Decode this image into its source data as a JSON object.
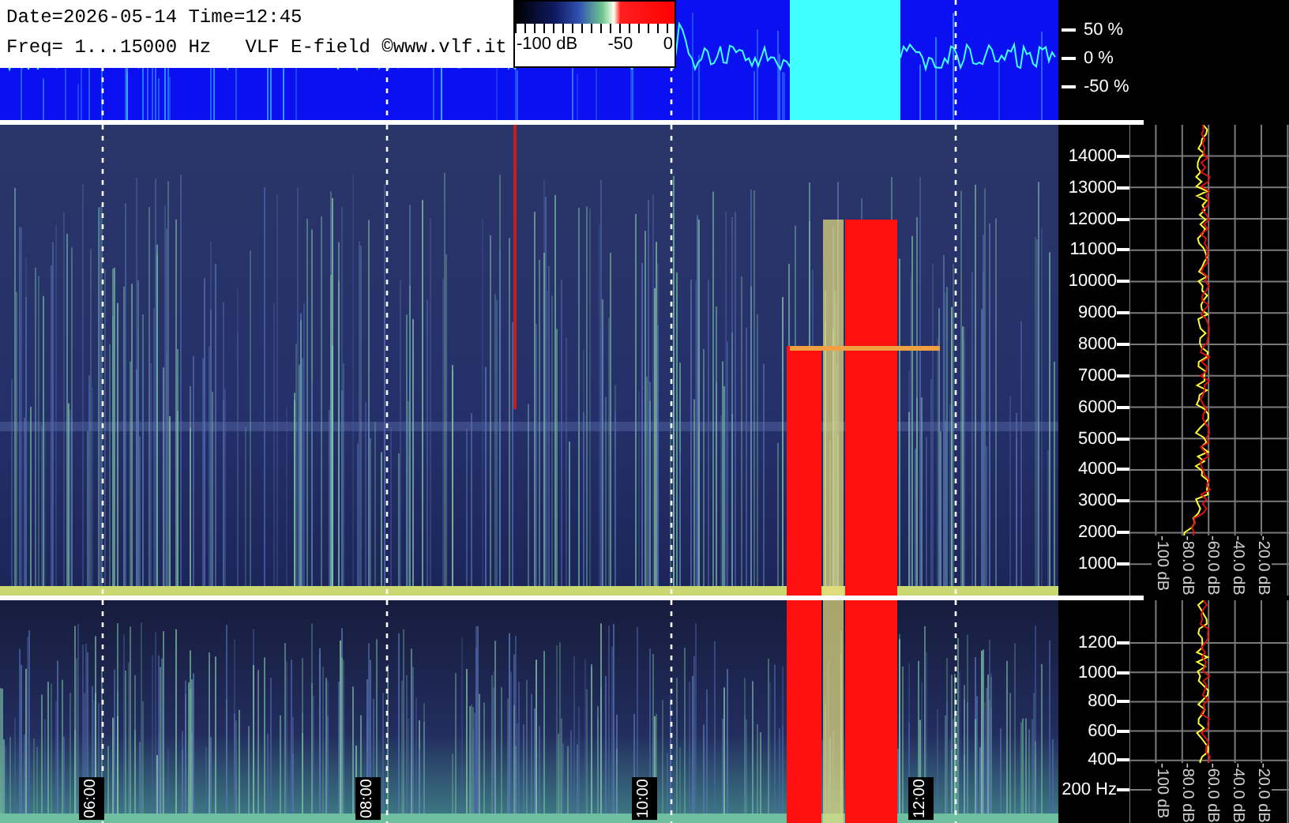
{
  "header": {
    "date_line": "Date=2026-05-14 Time=12:45",
    "freq_line": "Freq= 1...15000 Hz   VLF E-field ©www.vlf.it"
  },
  "colorbar": {
    "labels": [
      "-100 dB",
      "-50",
      "0"
    ]
  },
  "waveform": {
    "axis_labels": [
      "50 %",
      "0 %",
      "-50 %"
    ]
  },
  "upper_panel": {
    "freq_labels": [
      "14000",
      "13000",
      "12000",
      "11000",
      "10000",
      "9000",
      "8000",
      "7000",
      "6000",
      "5000",
      "4000",
      "3000",
      "2000",
      "1000"
    ],
    "db_labels": [
      "-100 dB",
      "-80.0 dB",
      "-60.0 dB",
      "-40.0 dB",
      "-20.0 dB"
    ]
  },
  "lower_panel": {
    "freq_labels": [
      "1200",
      "1000",
      "800",
      "600",
      "400",
      "200 Hz"
    ],
    "db_labels": [
      "-100 dB",
      "-80.0 dB",
      "-60.0 dB",
      "-40.0 dB",
      "-20.0 dB"
    ]
  },
  "time_labels": [
    "06:00",
    "08:00",
    "10:00",
    "12:00"
  ]
}
